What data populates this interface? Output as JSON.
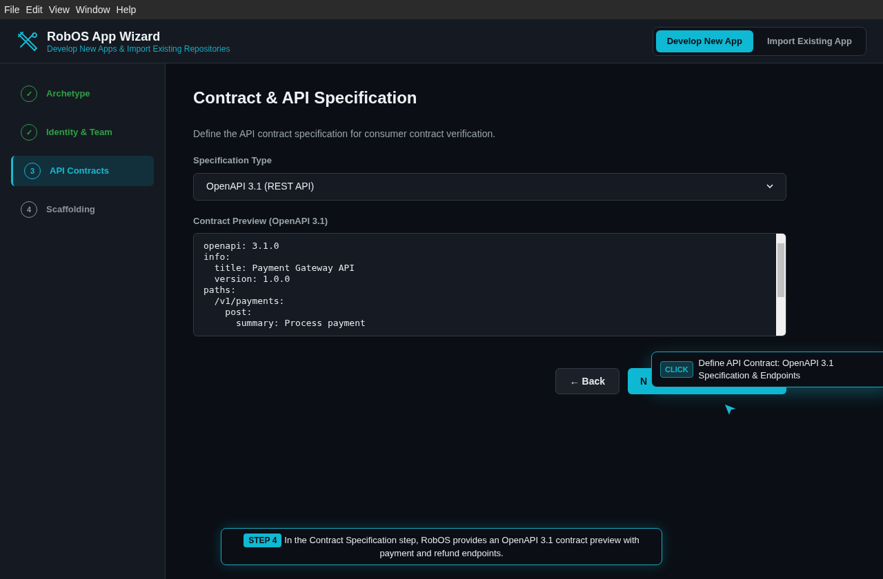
{
  "menu": [
    "File",
    "Edit",
    "View",
    "Window",
    "Help"
  ],
  "header": {
    "title": "RobOS App Wizard",
    "subtitle": "Develop New Apps & Import Existing Repositories"
  },
  "mode_tabs": [
    {
      "label": "Develop New App",
      "selected": true
    },
    {
      "label": "Import Existing App",
      "selected": false
    }
  ],
  "steps": [
    {
      "marker": "✓",
      "label": "Archetype",
      "completed": true,
      "selected": false
    },
    {
      "marker": "✓",
      "label": "Identity & Team",
      "completed": true,
      "selected": false
    },
    {
      "marker": "3",
      "label": "API Contracts",
      "completed": false,
      "selected": true
    },
    {
      "marker": "4",
      "label": "Scaffolding",
      "completed": false,
      "selected": false
    }
  ],
  "page": {
    "title": "Contract & API Specification",
    "description": "Define the API contract specification for consumer contract verification."
  },
  "spec_type": {
    "label": "Specification Type",
    "value": "OpenAPI 3.1 (REST API)"
  },
  "contract_preview": {
    "label": "Contract Preview (OpenAPI 3.1)",
    "lines": [
      "openapi: 3.1.0",
      "info:",
      "  title: Payment Gateway API",
      "  version: 1.0.0",
      "paths:",
      "  /v1/payments:",
      "    post:",
      "      summary: Process payment"
    ]
  },
  "buttons": {
    "back": "← Back",
    "next": "N"
  },
  "tooltip": {
    "badge": "CLICK",
    "text": "Define API Contract: OpenAPI 3.1 Specification & Endpoints"
  },
  "caption": {
    "badge": "STEP 4",
    "text": "In the Contract Specification step, RobOS provides an OpenAPI 3.1 contract preview with payment and refund endpoints."
  }
}
